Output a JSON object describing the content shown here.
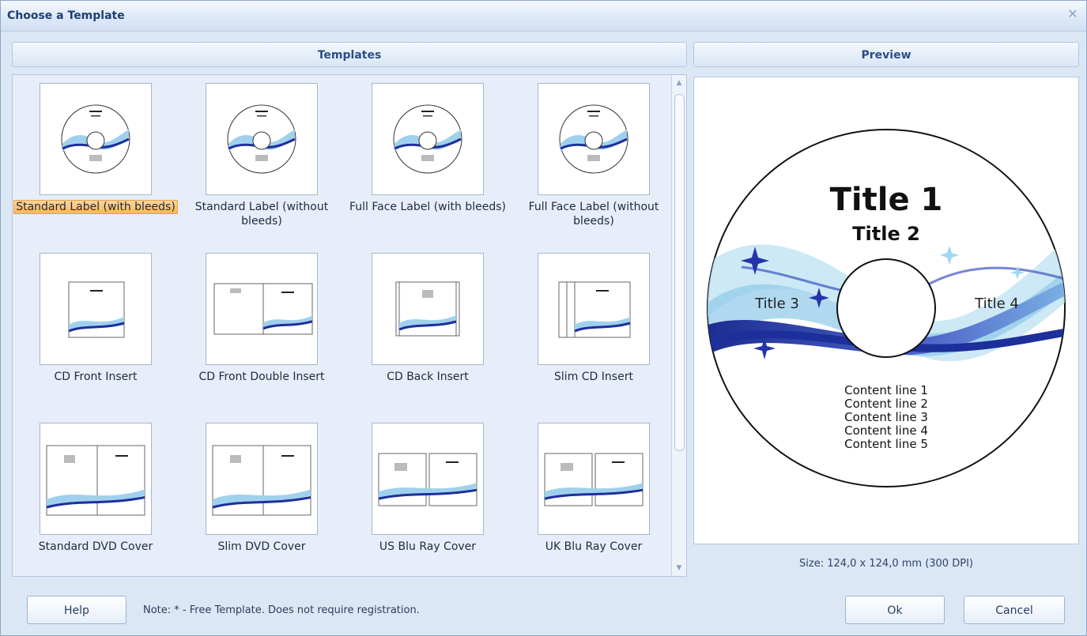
{
  "window": {
    "title": "Choose a Template",
    "close_icon": "close-icon"
  },
  "templates": {
    "header": "Templates",
    "items": [
      {
        "label": "Standard Label (with bleeds)",
        "selected": true,
        "kind": "cd"
      },
      {
        "label": "Standard Label (without bleeds)",
        "kind": "cd"
      },
      {
        "label": "Full Face Label (with bleeds)",
        "kind": "cd"
      },
      {
        "label": "Full Face Label (without bleeds)",
        "kind": "cd"
      },
      {
        "label": "CD Front Insert",
        "kind": "insert"
      },
      {
        "label": "CD Front Double Insert",
        "kind": "double"
      },
      {
        "label": "CD Back Insert",
        "kind": "back"
      },
      {
        "label": "Slim CD Insert",
        "kind": "slim"
      },
      {
        "label": "Standard DVD Cover",
        "kind": "dvd"
      },
      {
        "label": "Slim DVD Cover",
        "kind": "dvd"
      },
      {
        "label": "US Blu Ray Cover",
        "kind": "bluray"
      },
      {
        "label": "UK Blu Ray Cover",
        "kind": "bluray"
      }
    ]
  },
  "preview": {
    "header": "Preview",
    "title1": "Title 1",
    "title2": "Title 2",
    "title3": "Title 3",
    "title4": "Title 4",
    "content_lines": [
      "Content line 1",
      "Content line 2",
      "Content line 3",
      "Content line 4",
      "Content line 5"
    ],
    "size": "Size: 124,0 x 124,0 mm (300 DPI)"
  },
  "footer": {
    "help": "Help",
    "note": "Note: * - Free Template. Does not require registration.",
    "ok": "Ok",
    "cancel": "Cancel"
  }
}
